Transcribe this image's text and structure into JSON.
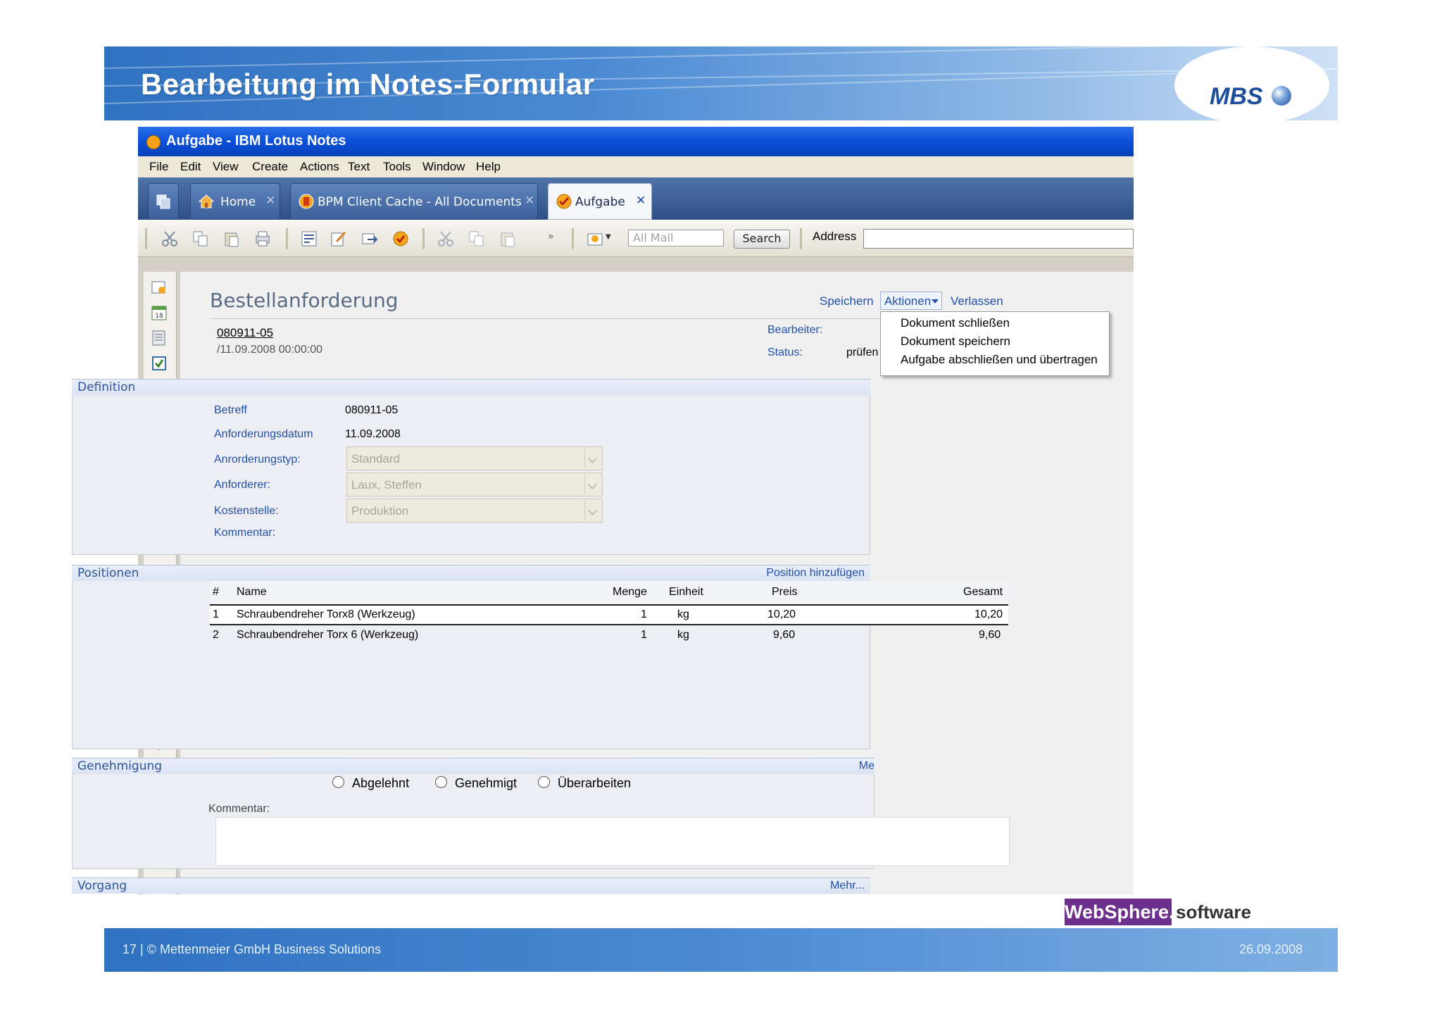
{
  "slide": {
    "title": "Bearbeitung im Notes-Formular",
    "logo": "MBS",
    "footer_text": "17 | © Mettenmeier GmbH Business Solutions",
    "footer_date": "26.09.2008",
    "badge_websphere": "WebSphere.",
    "badge_software": "software"
  },
  "window": {
    "title": "Aufgabe - IBM Lotus Notes",
    "menu": [
      "File",
      "Edit",
      "View",
      "Create",
      "Actions",
      "Text",
      "Tools",
      "Window",
      "Help"
    ],
    "tabs": [
      {
        "label": "Home",
        "icon": "home-icon"
      },
      {
        "label": "BPM Client Cache - All Documents",
        "icon": "lotus-notes-icon"
      },
      {
        "label": "Aufgabe",
        "icon": "task-icon"
      }
    ],
    "toolbar": {
      "search_placeholder": "All Mail",
      "search_button": "Search",
      "address_label": "Address"
    }
  },
  "form": {
    "title": "Bestellanforderung",
    "actions": {
      "save": "Speichern",
      "aktionen": "Aktionen",
      "leave": "Verlassen"
    },
    "menu_items": [
      "Dokument schließen",
      "Dokument speichern",
      "Aufgabe abschließen und übertragen"
    ],
    "doc_id": "080911-05",
    "doc_date": "/11.09.2008 00:00:00",
    "bearbeiter_label": "Bearbeiter:",
    "status_label": "Status:",
    "status_value": "prüfen",
    "definition": {
      "title": "Definition",
      "fields": [
        {
          "label": "Betreff",
          "value": "080911-05"
        },
        {
          "label": "Anforderungsdatum",
          "value": "11.09.2008"
        },
        {
          "label": "Anrorderungstyp:",
          "value": "Standard"
        },
        {
          "label": "Anforderer:",
          "value": "Laux, Steffen"
        },
        {
          "label": "Kostenstelle:",
          "value": "Produktion"
        },
        {
          "label": "Kommentar:",
          "value": ""
        }
      ]
    },
    "positionen": {
      "title": "Positionen",
      "add_link": "Position hinzufügen",
      "columns": [
        "#",
        "Name",
        "Menge",
        "Einheit",
        "Preis",
        "Gesamt"
      ],
      "rows": [
        {
          "nr": "1",
          "name": "Schraubendreher Torx8 (Werkzeug)",
          "menge": "1",
          "einheit": "kg",
          "preis": "10,20",
          "gesamt": "10,20"
        },
        {
          "nr": "2",
          "name": "Schraubendreher Torx 6 (Werkzeug)",
          "menge": "1",
          "einheit": "kg",
          "preis": "9,60",
          "gesamt": "9,60"
        }
      ]
    },
    "genehmigung": {
      "title": "Genehmigung",
      "right_link": "Me",
      "options": [
        "Abgelehnt",
        "Genehmigt",
        "Überarbeiten"
      ],
      "comment_label": "Kommentar:"
    },
    "vorgang": {
      "title": "Vorgang",
      "more": "Mehr..."
    }
  },
  "colors": {
    "banner": "#2f72c0",
    "titlebar": "#0a4fd8",
    "link": "#2250a8",
    "websphere": "#6c2f8c"
  }
}
